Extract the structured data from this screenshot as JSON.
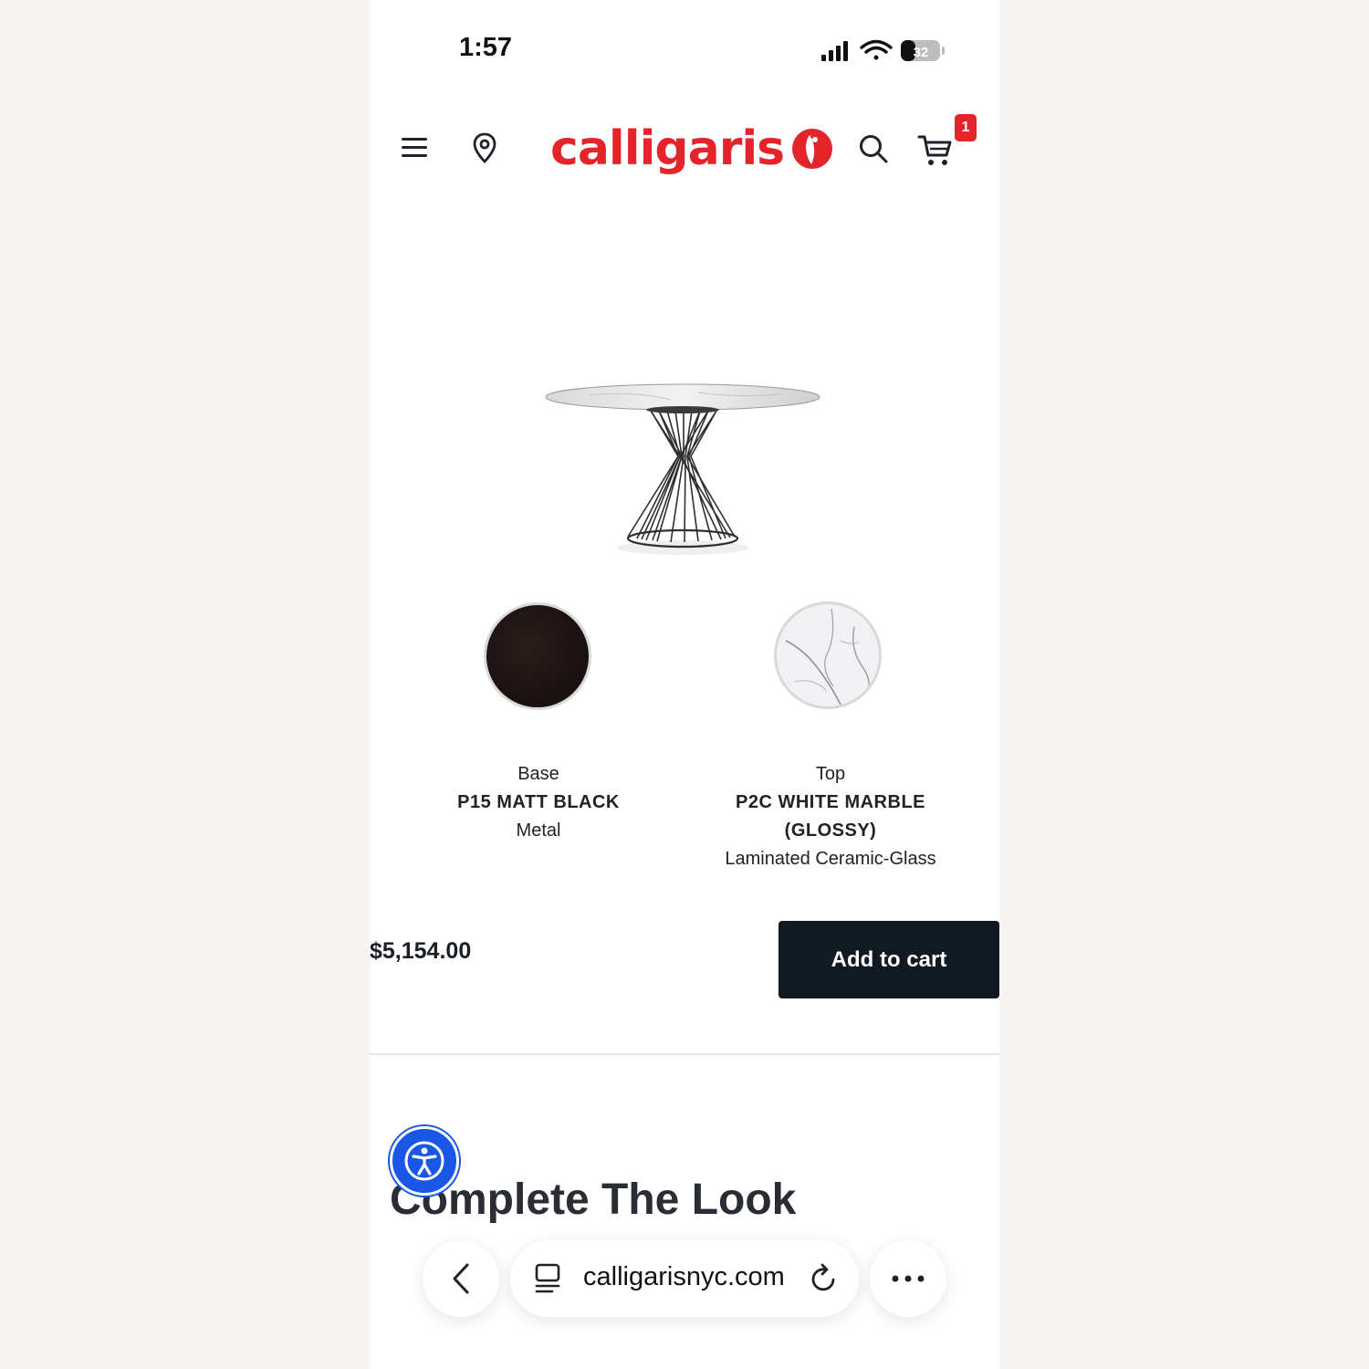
{
  "status": {
    "time": "1:57",
    "battery": "32"
  },
  "header": {
    "brand": "calligaris",
    "cart_count": "1",
    "brand_color": "#e5232b",
    "icons": [
      "menu-icon",
      "location-pin-icon",
      "search-icon",
      "cart-icon"
    ]
  },
  "finishes": [
    {
      "label": "Base",
      "value": "P15 MATT BLACK",
      "material": "Metal",
      "swatch_color": "#1a1210"
    },
    {
      "label": "Top",
      "value_line1": "P2C WHITE MARBLE",
      "value_line2": "(GLOSSY)",
      "material": "Laminated Ceramic-Glass",
      "swatch_color": "#f2f2f4"
    }
  ],
  "purchase": {
    "price": "$5,154.00",
    "add_to_cart_label": "Add to cart",
    "button_color": "#111922"
  },
  "section": {
    "title": "Complete The Look"
  },
  "browser": {
    "url": "calligarisnyc.com"
  }
}
